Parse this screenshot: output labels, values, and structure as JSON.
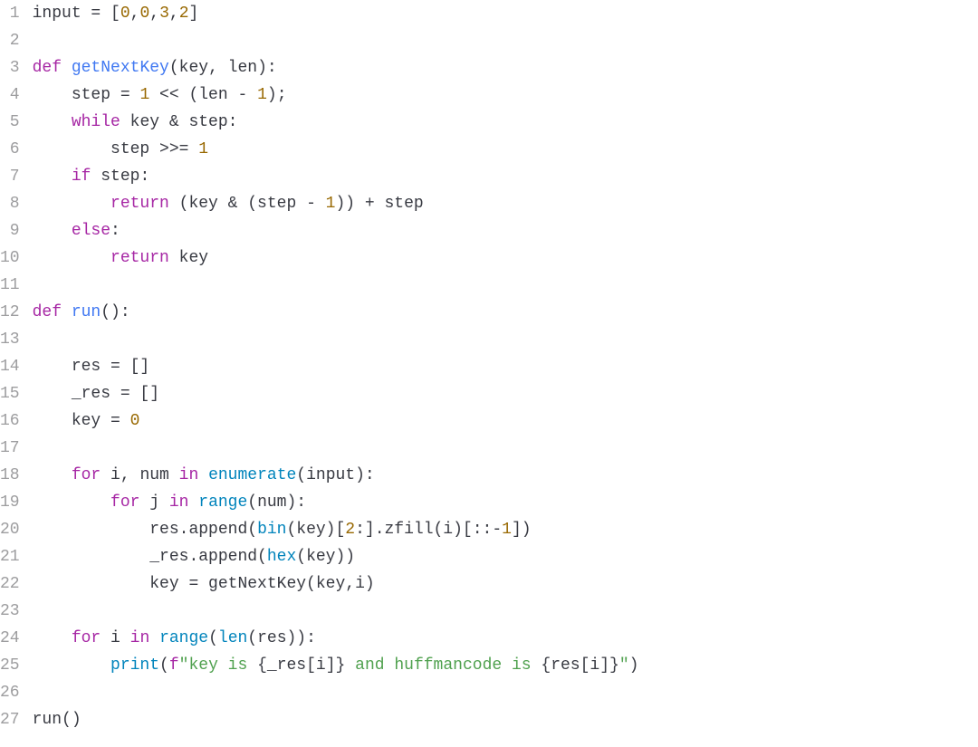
{
  "editor": {
    "language": "python",
    "theme": "light",
    "lines": [
      {
        "num": "1",
        "tokens": [
          {
            "t": "input",
            "c": "id"
          },
          {
            "t": " = [",
            "c": "op"
          },
          {
            "t": "0",
            "c": "nm"
          },
          {
            "t": ",",
            "c": "op"
          },
          {
            "t": "0",
            "c": "nm"
          },
          {
            "t": ",",
            "c": "op"
          },
          {
            "t": "3",
            "c": "nm"
          },
          {
            "t": ",",
            "c": "op"
          },
          {
            "t": "2",
            "c": "nm"
          },
          {
            "t": "]",
            "c": "op"
          }
        ]
      },
      {
        "num": "2",
        "tokens": []
      },
      {
        "num": "3",
        "tokens": [
          {
            "t": "def",
            "c": "kw"
          },
          {
            "t": " ",
            "c": ""
          },
          {
            "t": "getNextKey",
            "c": "fn"
          },
          {
            "t": "(key, len):",
            "c": "op"
          }
        ]
      },
      {
        "num": "4",
        "tokens": [
          {
            "t": "    step = ",
            "c": "op"
          },
          {
            "t": "1",
            "c": "nm"
          },
          {
            "t": " << (len - ",
            "c": "op"
          },
          {
            "t": "1",
            "c": "nm"
          },
          {
            "t": ");",
            "c": "op"
          }
        ]
      },
      {
        "num": "5",
        "tokens": [
          {
            "t": "    ",
            "c": ""
          },
          {
            "t": "while",
            "c": "kw"
          },
          {
            "t": " key & step:",
            "c": "op"
          }
        ]
      },
      {
        "num": "6",
        "tokens": [
          {
            "t": "        step >>= ",
            "c": "op"
          },
          {
            "t": "1",
            "c": "nm"
          }
        ]
      },
      {
        "num": "7",
        "tokens": [
          {
            "t": "    ",
            "c": ""
          },
          {
            "t": "if",
            "c": "kw"
          },
          {
            "t": " step:",
            "c": "op"
          }
        ]
      },
      {
        "num": "8",
        "tokens": [
          {
            "t": "        ",
            "c": ""
          },
          {
            "t": "return",
            "c": "kw"
          },
          {
            "t": " (key & (step - ",
            "c": "op"
          },
          {
            "t": "1",
            "c": "nm"
          },
          {
            "t": ")) + step",
            "c": "op"
          }
        ]
      },
      {
        "num": "9",
        "tokens": [
          {
            "t": "    ",
            "c": ""
          },
          {
            "t": "else",
            "c": "kw"
          },
          {
            "t": ":",
            "c": "op"
          }
        ]
      },
      {
        "num": "10",
        "tokens": [
          {
            "t": "        ",
            "c": ""
          },
          {
            "t": "return",
            "c": "kw"
          },
          {
            "t": " key",
            "c": "op"
          }
        ]
      },
      {
        "num": "11",
        "tokens": []
      },
      {
        "num": "12",
        "tokens": [
          {
            "t": "def",
            "c": "kw"
          },
          {
            "t": " ",
            "c": ""
          },
          {
            "t": "run",
            "c": "fn"
          },
          {
            "t": "():",
            "c": "op"
          }
        ]
      },
      {
        "num": "13",
        "tokens": []
      },
      {
        "num": "14",
        "tokens": [
          {
            "t": "    res = []",
            "c": "op"
          }
        ]
      },
      {
        "num": "15",
        "tokens": [
          {
            "t": "    _res = []",
            "c": "op"
          }
        ]
      },
      {
        "num": "16",
        "tokens": [
          {
            "t": "    key = ",
            "c": "op"
          },
          {
            "t": "0",
            "c": "nm"
          }
        ]
      },
      {
        "num": "17",
        "tokens": []
      },
      {
        "num": "18",
        "tokens": [
          {
            "t": "    ",
            "c": ""
          },
          {
            "t": "for",
            "c": "kw"
          },
          {
            "t": " i, num ",
            "c": "op"
          },
          {
            "t": "in",
            "c": "kw"
          },
          {
            "t": " ",
            "c": ""
          },
          {
            "t": "enumerate",
            "c": "bi"
          },
          {
            "t": "(input):",
            "c": "op"
          }
        ]
      },
      {
        "num": "19",
        "tokens": [
          {
            "t": "        ",
            "c": ""
          },
          {
            "t": "for",
            "c": "kw"
          },
          {
            "t": " j ",
            "c": "op"
          },
          {
            "t": "in",
            "c": "kw"
          },
          {
            "t": " ",
            "c": ""
          },
          {
            "t": "range",
            "c": "bi"
          },
          {
            "t": "(num):",
            "c": "op"
          }
        ]
      },
      {
        "num": "20",
        "tokens": [
          {
            "t": "            res.append(",
            "c": "op"
          },
          {
            "t": "bin",
            "c": "bi"
          },
          {
            "t": "(key)[",
            "c": "op"
          },
          {
            "t": "2",
            "c": "nm"
          },
          {
            "t": ":].zfill(i)[::-",
            "c": "op"
          },
          {
            "t": "1",
            "c": "nm"
          },
          {
            "t": "])",
            "c": "op"
          }
        ]
      },
      {
        "num": "21",
        "tokens": [
          {
            "t": "            _res.append(",
            "c": "op"
          },
          {
            "t": "hex",
            "c": "bi"
          },
          {
            "t": "(key))",
            "c": "op"
          }
        ]
      },
      {
        "num": "22",
        "tokens": [
          {
            "t": "            key = getNextKey(key,i)",
            "c": "op"
          }
        ]
      },
      {
        "num": "23",
        "tokens": []
      },
      {
        "num": "24",
        "tokens": [
          {
            "t": "    ",
            "c": ""
          },
          {
            "t": "for",
            "c": "kw"
          },
          {
            "t": " i ",
            "c": "op"
          },
          {
            "t": "in",
            "c": "kw"
          },
          {
            "t": " ",
            "c": ""
          },
          {
            "t": "range",
            "c": "bi"
          },
          {
            "t": "(",
            "c": "op"
          },
          {
            "t": "len",
            "c": "bi"
          },
          {
            "t": "(res)):",
            "c": "op"
          }
        ]
      },
      {
        "num": "25",
        "tokens": [
          {
            "t": "        ",
            "c": ""
          },
          {
            "t": "print",
            "c": "bi"
          },
          {
            "t": "(",
            "c": "op"
          },
          {
            "t": "f",
            "c": "fprefix"
          },
          {
            "t": "\"key is ",
            "c": "str"
          },
          {
            "t": "{",
            "c": "op"
          },
          {
            "t": "_res[i]",
            "c": "op"
          },
          {
            "t": "}",
            "c": "op"
          },
          {
            "t": " and huffmancode is ",
            "c": "str"
          },
          {
            "t": "{",
            "c": "op"
          },
          {
            "t": "res[i]",
            "c": "op"
          },
          {
            "t": "}",
            "c": "op"
          },
          {
            "t": "\"",
            "c": "str"
          },
          {
            "t": ")",
            "c": "op"
          }
        ]
      },
      {
        "num": "26",
        "tokens": []
      },
      {
        "num": "27",
        "tokens": [
          {
            "t": "run()",
            "c": "op"
          }
        ]
      }
    ]
  }
}
